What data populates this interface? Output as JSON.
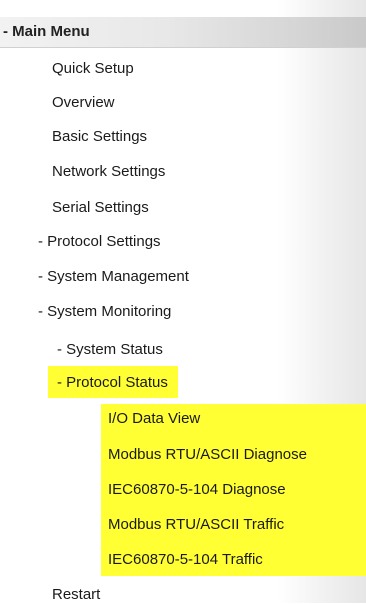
{
  "menu": {
    "title": "- Main Menu",
    "items": [
      {
        "label": "Quick Setup"
      },
      {
        "label": "Overview"
      },
      {
        "label": "Basic Settings"
      },
      {
        "label": "Network Settings"
      },
      {
        "label": "Serial Settings"
      },
      {
        "label": "- Protocol Settings"
      },
      {
        "label": "- System Management"
      },
      {
        "label": "- System Monitoring"
      },
      {
        "label": "- System Status"
      },
      {
        "label": "- Protocol Status"
      },
      {
        "label": "I/O Data View"
      },
      {
        "label": "Modbus RTU/ASCII Diagnose"
      },
      {
        "label": "IEC60870-5-104 Diagnose"
      },
      {
        "label": "Modbus RTU/ASCII Traffic"
      },
      {
        "label": "IEC60870-5-104 Traffic"
      },
      {
        "label": "Restart"
      }
    ]
  },
  "highlight_color": "#ffff33"
}
